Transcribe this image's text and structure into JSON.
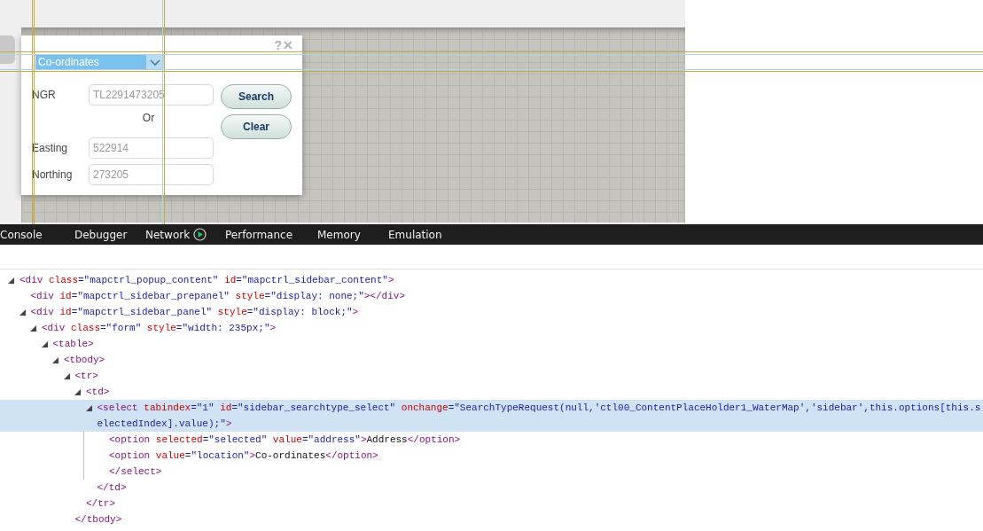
{
  "page": {
    "popup": {
      "help": "?",
      "close": "✕",
      "search_type": {
        "value": "Co-ordinates",
        "highlighted": true
      },
      "form": [
        {
          "kind": "field",
          "label": "NGR",
          "value": "TL2291473205"
        },
        {
          "kind": "separator",
          "text": "Or"
        },
        {
          "kind": "field",
          "label": "Easting",
          "value": "522914"
        },
        {
          "kind": "field",
          "label": "Northing",
          "value": "273205"
        }
      ],
      "buttons": [
        "Search",
        "Clear"
      ]
    }
  },
  "devtools": {
    "tabs": [
      {
        "label": "Console",
        "selected": false,
        "recording": false
      },
      {
        "label": "Debugger",
        "selected": false,
        "recording": false
      },
      {
        "label": "Network",
        "selected": false,
        "recording": true
      },
      {
        "label": "Performance",
        "selected": false,
        "recording": false
      },
      {
        "label": "Memory",
        "selected": false,
        "recording": false
      },
      {
        "label": "Emulation",
        "selected": false,
        "recording": false
      }
    ],
    "dom_tree": [
      {
        "expanded": true,
        "selected": false,
        "line": [
          {
            "kind": "tag",
            "text": "<div"
          },
          {
            "kind": "attr",
            "text": " class"
          },
          {
            "kind": "punct",
            "text": "=\""
          },
          {
            "kind": "value",
            "text": "mapctrl_popup_content"
          },
          {
            "kind": "punct",
            "text": "\""
          },
          {
            "kind": "attr",
            "text": " id"
          },
          {
            "kind": "punct",
            "text": "=\""
          },
          {
            "kind": "value",
            "text": "mapctrl_sidebar_content"
          },
          {
            "kind": "punct",
            "text": "\""
          },
          {
            "kind": "tag",
            "text": ">"
          }
        ],
        "children": [
          {
            "selected": false,
            "line": [
              {
                "kind": "tag",
                "text": "<div"
              },
              {
                "kind": "attr",
                "text": " id"
              },
              {
                "kind": "punct",
                "text": "=\""
              },
              {
                "kind": "value",
                "text": "mapctrl_sidebar_prepanel"
              },
              {
                "kind": "punct",
                "text": "\""
              },
              {
                "kind": "attr",
                "text": " style"
              },
              {
                "kind": "punct",
                "text": "=\""
              },
              {
                "kind": "value",
                "text": "display: none;"
              },
              {
                "kind": "punct",
                "text": "\""
              },
              {
                "kind": "tag",
                "text": "></div>"
              }
            ]
          },
          {
            "expanded": true,
            "selected": false,
            "line": [
              {
                "kind": "tag",
                "text": "<div"
              },
              {
                "kind": "attr",
                "text": " id"
              },
              {
                "kind": "punct",
                "text": "=\""
              },
              {
                "kind": "value",
                "text": "mapctrl_sidebar_panel"
              },
              {
                "kind": "punct",
                "text": "\""
              },
              {
                "kind": "attr",
                "text": " style"
              },
              {
                "kind": "punct",
                "text": "=\""
              },
              {
                "kind": "value",
                "text": "display: block;"
              },
              {
                "kind": "punct",
                "text": "\""
              },
              {
                "kind": "tag",
                "text": ">"
              }
            ],
            "children": [
              {
                "expanded": true,
                "selected": false,
                "line": [
                  {
                    "kind": "tag",
                    "text": "<div"
                  },
                  {
                    "kind": "attr",
                    "text": " class"
                  },
                  {
                    "kind": "punct",
                    "text": "=\""
                  },
                  {
                    "kind": "value",
                    "text": "form"
                  },
                  {
                    "kind": "punct",
                    "text": "\""
                  },
                  {
                    "kind": "attr",
                    "text": " style"
                  },
                  {
                    "kind": "punct",
                    "text": "=\""
                  },
                  {
                    "kind": "value",
                    "text": "width: 235px;"
                  },
                  {
                    "kind": "punct",
                    "text": "\""
                  },
                  {
                    "kind": "tag",
                    "text": ">"
                  }
                ],
                "children": [
                  {
                    "expanded": true,
                    "selected": false,
                    "line": [
                      {
                        "kind": "tag",
                        "text": "<table>"
                      }
                    ],
                    "children": [
                      {
                        "expanded": true,
                        "selected": false,
                        "line": [
                          {
                            "kind": "tag",
                            "text": "<tbody>"
                          }
                        ],
                        "children": [
                          {
                            "expanded": true,
                            "selected": false,
                            "line": [
                              {
                                "kind": "tag",
                                "text": "<tr>"
                              }
                            ],
                            "children": [
                              {
                                "expanded": true,
                                "selected": false,
                                "line": [
                                  {
                                    "kind": "tag",
                                    "text": "<td>"
                                  }
                                ],
                                "children": [
                                  {
                                    "expanded": true,
                                    "selected": true,
                                    "line": [
                                      {
                                        "kind": "tag",
                                        "text": "<select"
                                      },
                                      {
                                        "kind": "attr",
                                        "text": " tabindex"
                                      },
                                      {
                                        "kind": "punct",
                                        "text": "=\""
                                      },
                                      {
                                        "kind": "value",
                                        "text": "1"
                                      },
                                      {
                                        "kind": "punct",
                                        "text": "\""
                                      },
                                      {
                                        "kind": "attr",
                                        "text": " id"
                                      },
                                      {
                                        "kind": "punct",
                                        "text": "=\""
                                      },
                                      {
                                        "kind": "value",
                                        "text": "sidebar_searchtype_select"
                                      },
                                      {
                                        "kind": "punct",
                                        "text": "\""
                                      },
                                      {
                                        "kind": "attr",
                                        "text": " onchange"
                                      },
                                      {
                                        "kind": "punct",
                                        "text": "=\""
                                      },
                                      {
                                        "kind": "value",
                                        "text": "SearchTypeRequest(null,'ctl00_ContentPlaceHolder1_WaterMap','sidebar',this.options[this.selectedIndex].value);"
                                      },
                                      {
                                        "kind": "punct",
                                        "text": "\""
                                      },
                                      {
                                        "kind": "tag",
                                        "text": ">"
                                      }
                                    ],
                                    "children": [
                                      {
                                        "selected": false,
                                        "line": [
                                          {
                                            "kind": "tag",
                                            "text": "<option"
                                          },
                                          {
                                            "kind": "attr",
                                            "text": " selected"
                                          },
                                          {
                                            "kind": "punct",
                                            "text": "=\""
                                          },
                                          {
                                            "kind": "value",
                                            "text": "selected"
                                          },
                                          {
                                            "kind": "punct",
                                            "text": "\""
                                          },
                                          {
                                            "kind": "attr",
                                            "text": " value"
                                          },
                                          {
                                            "kind": "punct",
                                            "text": "=\""
                                          },
                                          {
                                            "kind": "value",
                                            "text": "address"
                                          },
                                          {
                                            "kind": "punct",
                                            "text": "\""
                                          },
                                          {
                                            "kind": "tag",
                                            "text": ">"
                                          },
                                          {
                                            "kind": "text",
                                            "text": "Address"
                                          },
                                          {
                                            "kind": "tag",
                                            "text": "</option>"
                                          }
                                        ]
                                      },
                                      {
                                        "selected": false,
                                        "line": [
                                          {
                                            "kind": "tag",
                                            "text": "<option"
                                          },
                                          {
                                            "kind": "attr",
                                            "text": " value"
                                          },
                                          {
                                            "kind": "punct",
                                            "text": "=\""
                                          },
                                          {
                                            "kind": "value",
                                            "text": "location"
                                          },
                                          {
                                            "kind": "punct",
                                            "text": "\""
                                          },
                                          {
                                            "kind": "tag",
                                            "text": ">"
                                          },
                                          {
                                            "kind": "text",
                                            "text": "Co-ordinates"
                                          },
                                          {
                                            "kind": "tag",
                                            "text": "</option>"
                                          }
                                        ]
                                      }
                                    ],
                                    "close": [
                                      {
                                        "kind": "tag",
                                        "text": "</select>"
                                      }
                                    ]
                                  }
                                ],
                                "close": [
                                  {
                                    "kind": "tag",
                                    "text": "</td>"
                                  }
                                ]
                              }
                            ],
                            "close": [
                              {
                                "kind": "tag",
                                "text": "</tr>"
                              }
                            ]
                          }
                        ],
                        "close": [
                          {
                            "kind": "tag",
                            "text": "</tbody>"
                          }
                        ]
                      }
                    ]
                  }
                ]
              }
            ]
          }
        ]
      }
    ]
  }
}
